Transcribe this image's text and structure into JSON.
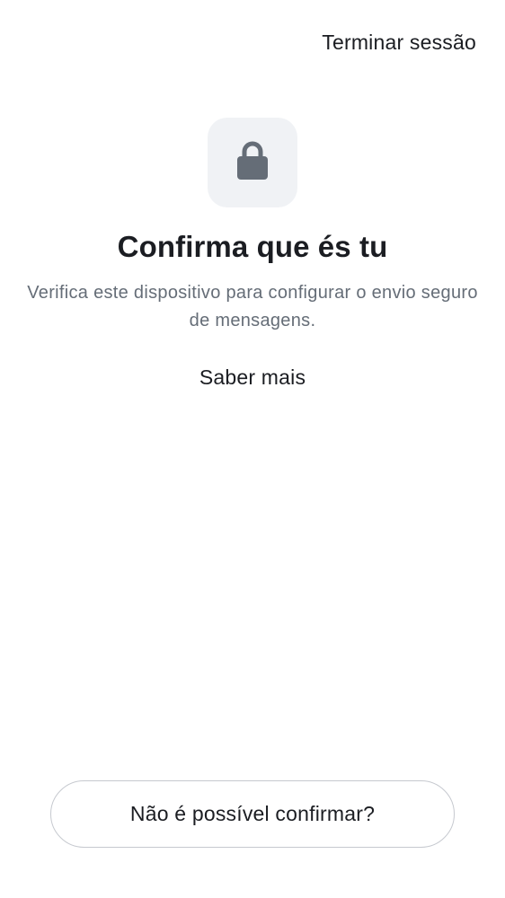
{
  "header": {
    "signout_label": "Terminar sessão"
  },
  "hero": {
    "icon": "lock-icon",
    "title": "Confirma que és tu",
    "description": "Verifica este dispositivo para configurar o envio seguro de mensagens.",
    "learn_more_label": "Saber mais"
  },
  "footer": {
    "cant_confirm_label": "Não é possível confirmar?"
  },
  "colors": {
    "text_primary": "#1b1d22",
    "text_secondary": "#656d77",
    "icon_tile_bg": "#f0f2f5",
    "icon_fill": "#656d77",
    "button_border": "#c6c9cf"
  }
}
